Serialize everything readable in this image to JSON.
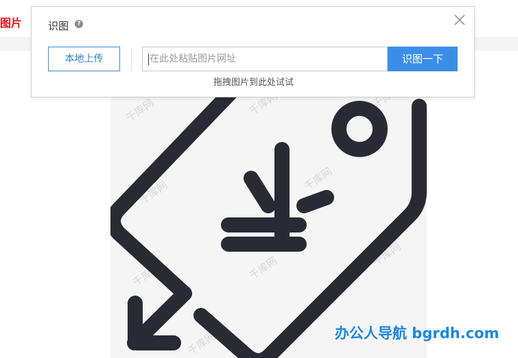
{
  "page": {
    "left_label": "图片",
    "bottom_watermark": "办公人导航 bgrdh.com",
    "image_watermark": "千库网"
  },
  "dialog": {
    "title": "识图",
    "help_icon": "question-circle-icon",
    "close_icon": "close-icon",
    "upload_label": "本地上传",
    "url_placeholder": "在此处粘贴图片网址",
    "search_label": "识图一下",
    "drag_hint": "拖拽图片到此处试试"
  },
  "colors": {
    "accent": "#3b8ee8",
    "brand_red": "#e0141e",
    "icon_dark": "#2a2a35"
  }
}
